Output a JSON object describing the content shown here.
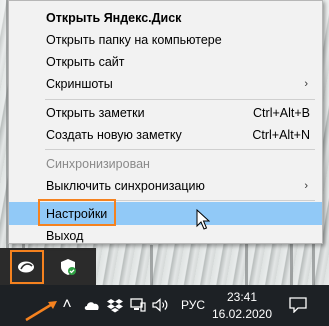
{
  "menu": {
    "items": [
      {
        "label": "Открыть Яндекс.Диск",
        "style": "bold"
      },
      {
        "label": "Открыть папку на компьютере"
      },
      {
        "label": "Открыть сайт"
      },
      {
        "label": "Скриншоты",
        "submenu": true
      },
      {
        "label": "Открыть заметки",
        "shortcut": "Ctrl+Alt+B"
      },
      {
        "label": "Создать новую заметку",
        "shortcut": "Ctrl+Alt+N"
      },
      {
        "label": "Синхронизирован",
        "state": "disabled"
      },
      {
        "label": "Выключить синхронизацию",
        "submenu": true
      },
      {
        "label": "Настройки",
        "state": "selected"
      },
      {
        "label": "Выход"
      }
    ],
    "submenu_arrow": "›"
  },
  "tray_flyout": {
    "icons": [
      "yandex-disk-icon",
      "windows-defender-icon"
    ]
  },
  "taskbar": {
    "show_hidden_icons": "˄",
    "tray_icons": [
      "onedrive-cloud-icon",
      "dropbox-icon",
      "network-icon",
      "volume-icon"
    ],
    "language": "РУС",
    "time": "23:41",
    "date": "16.02.2020"
  },
  "colors": {
    "highlight_outline": "#f5821f",
    "menu_selected": "#91c9f7",
    "taskbar": "#1d2125"
  }
}
